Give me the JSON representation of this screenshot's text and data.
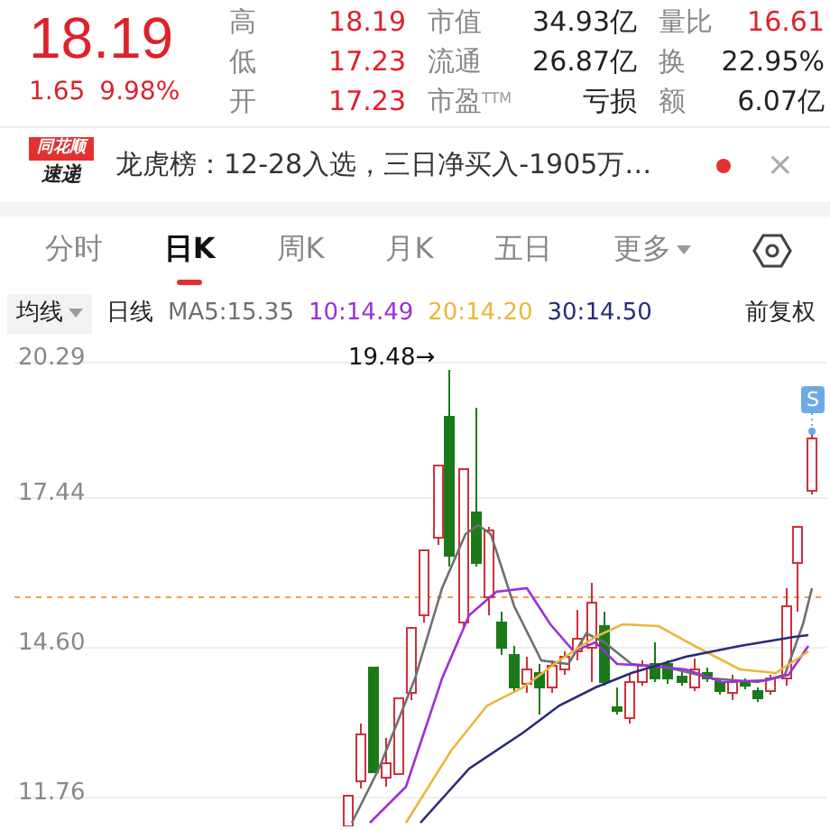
{
  "quote": {
    "price": "18.19",
    "change": "1.65",
    "change_pct": "9.98%"
  },
  "stats": [
    {
      "label": "高",
      "value": "18.19",
      "up": true
    },
    {
      "label": "市值",
      "value": "34.93亿",
      "up": false
    },
    {
      "label": "量比",
      "value": "16.61",
      "up": true
    },
    {
      "label": "低",
      "value": "17.23",
      "up": true
    },
    {
      "label": "流通",
      "value": "26.87亿",
      "up": false
    },
    {
      "label": "换",
      "value": "22.95%",
      "up": false
    },
    {
      "label": "开",
      "value": "17.23",
      "up": true
    },
    {
      "label": "市盈$^{TTM}$",
      "value": "亏损",
      "up": false
    },
    {
      "label": "额",
      "value": "6.07亿",
      "up": false
    }
  ],
  "news": {
    "logo_top": "同花顺",
    "logo_bottom": "速递",
    "text": "龙虎榜：12-28入选，三日净买入-1905万…",
    "unread": true,
    "close": "×"
  },
  "tabs": [
    {
      "label": "分时",
      "selected": false
    },
    {
      "label": "日K",
      "selected": true
    },
    {
      "label": "周K",
      "selected": false
    },
    {
      "label": "月K",
      "selected": false
    },
    {
      "label": "五日",
      "selected": false
    },
    {
      "label": "更多",
      "selected": false,
      "dropdown": true
    }
  ],
  "ma_bar": {
    "selector": "均线",
    "period": "日线",
    "indicators": [
      {
        "label": "MA5:15.35",
        "color": "#6f6f6f"
      },
      {
        "label": "10:14.49",
        "color": "#9b30d9"
      },
      {
        "label": "20:14.20",
        "color": "#e8b83a"
      },
      {
        "label": "30:14.50",
        "color": "#2a2a7a"
      }
    ],
    "adjust": "前复权"
  },
  "chart": {
    "y_labels": [
      "20.29",
      "17.44",
      "14.60",
      "11.76"
    ],
    "high_marker": "19.48→",
    "signal": "S"
  }
}
